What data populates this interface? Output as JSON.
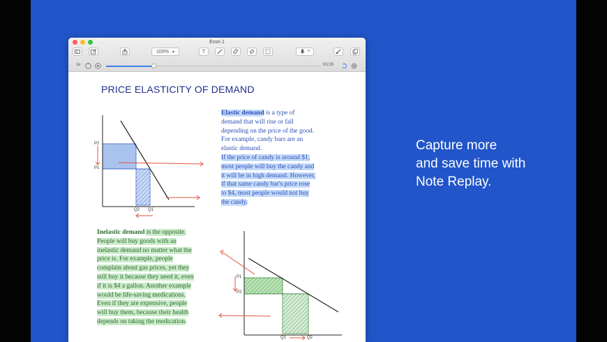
{
  "app": {
    "window_title": "Econ 1"
  },
  "toolbar": {
    "zoom": "100%",
    "text_tool": "T"
  },
  "replay": {
    "speed": "1x",
    "time": "01:15",
    "progress": 0.22
  },
  "note": {
    "title": "PRICE ELASTICITY OF DEMAND",
    "elastic_term": "Elastic demand",
    "elastic_def": " is a type of\ndemand that will rise or fall\ndepending on the price of the good.\nFor example, candy bars are an\nelastic demand.",
    "elastic_example": "If the price of candy is around $1,\nmost people will buy the candy and\nit will be in high demand. However,\nif that same candy bar's price rose\nto $4, most people would not buy\nthe candy.",
    "inelastic_term": "Inelastic demand",
    "inelastic_def": " is the opposite.\nPeople will buy goods with an\ninelastic demand no matter what the\nprice is. For example, people\ncomplain about gas prices, yet they\nstill buy it because they need it, even\nif it is $4 a gallon. Another example\nwould be life-saving medications.\nEven if they are expensive, people\nwill buy them, because their health\ndepends on taking the medication.",
    "graph1": {
      "p2": "P2",
      "p1": "P1",
      "q2": "Q2",
      "q1": "Q1"
    },
    "graph2": {
      "p1": "P1",
      "p2": "P2",
      "q1": "Q1",
      "q2": "Q2"
    }
  },
  "marketing": {
    "tagline": "Capture more\nand save time with\nNote Replay."
  },
  "colors": {
    "background": "#2155c9",
    "ink_blue": "#2c4fb8",
    "ink_green": "#2c6a2c",
    "arrow_red": "#e0533f"
  }
}
